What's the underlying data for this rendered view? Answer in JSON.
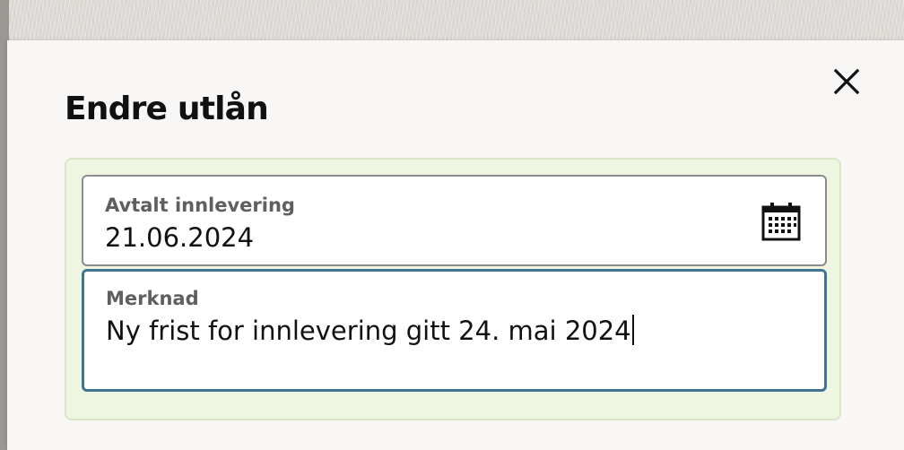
{
  "dialog": {
    "title": "Endre utlån",
    "close_icon": "close-icon"
  },
  "fields": {
    "due_date": {
      "label": "Avtalt innlevering",
      "value": "21.06.2024",
      "icon": "calendar-icon"
    },
    "note": {
      "label": "Merknad",
      "value": "Ny frist for innlevering gitt 24. mai 2024"
    }
  },
  "colors": {
    "panel_background": "#eef6e2",
    "panel_border": "#d8e6c6",
    "focus_border": "#3f7591",
    "modal_background": "#f8f7f5"
  }
}
